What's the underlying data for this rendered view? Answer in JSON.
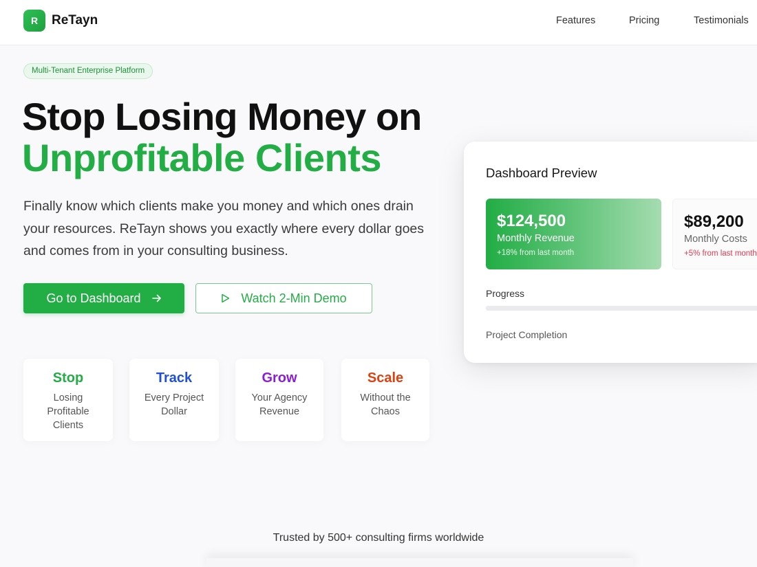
{
  "brand": {
    "name": "ReTayn",
    "logo_letter": "R"
  },
  "nav": {
    "items": [
      "Features",
      "Pricing",
      "Testimonials"
    ]
  },
  "hero": {
    "badge": "Multi-Tenant Enterprise Platform",
    "headline_line1": "Stop Losing Money on",
    "headline_line2": "Unprofitable Clients",
    "description": "Finally know which clients make you money and which ones drain your resources. ReTayn shows you exactly where every dollar goes and comes from in your consulting business.",
    "primary_button": "Go to Dashboard",
    "secondary_button": "Watch 2-Min Demo"
  },
  "features": [
    {
      "title": "Stop",
      "desc_lines": [
        "Losing",
        "Profitable",
        "Clients"
      ],
      "color": "#22ad45"
    },
    {
      "title": "Track",
      "desc_lines": [
        "Every Project",
        "Dollar"
      ],
      "color": "#1f4fd8"
    },
    {
      "title": "Grow",
      "desc_lines": [
        "Your Agency",
        "Revenue"
      ],
      "color": "#8a1ed8"
    },
    {
      "title": "Scale",
      "desc_lines": [
        "Without the",
        "Chaos"
      ],
      "color": "#e0400f"
    }
  ],
  "dashboard": {
    "title": "Dashboard Preview",
    "revenue": {
      "value": "$124,500",
      "label": "Monthly Revenue",
      "change": "+18% from last month"
    },
    "costs": {
      "value": "$89,200",
      "label": "Monthly Costs",
      "change": "+5% from last month"
    },
    "progress_label": "Progress",
    "progress_value": 0,
    "progress_caption": "Project Completion"
  },
  "footer": {
    "trusted": "Trusted by 500+ consulting firms worldwide"
  },
  "colors": {
    "accent": "#22ad45",
    "background": "#f9f9fb",
    "negative": "#e0394e"
  },
  "icons": {
    "primary_button_icon": "arrow-right-icon",
    "secondary_button_icon": "play-icon"
  }
}
